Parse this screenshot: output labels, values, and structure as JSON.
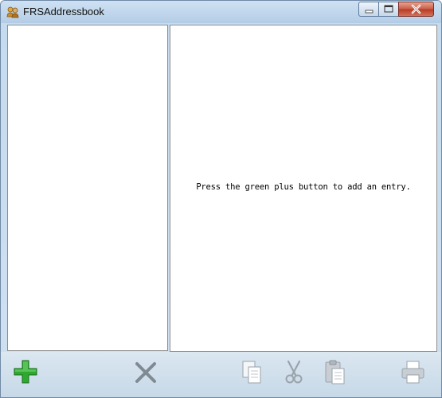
{
  "window": {
    "title": "FRSAddressbook",
    "icon": "addressbook-people-icon"
  },
  "controls": {
    "minimize_icon": "minimize-icon",
    "maximize_icon": "maximize-icon",
    "close_icon": "close-icon"
  },
  "main": {
    "empty_message": "Press the green plus button to add an entry."
  },
  "toolbar": {
    "items": [
      {
        "name": "add",
        "icon": "green-plus-icon",
        "color": "#2fa82f"
      },
      {
        "name": "delete",
        "icon": "x-delete-icon",
        "color": "#7f8a93"
      },
      {
        "name": "copy",
        "icon": "copy-icon"
      },
      {
        "name": "cut",
        "icon": "scissors-icon"
      },
      {
        "name": "paste",
        "icon": "clipboard-paste-icon"
      },
      {
        "name": "print",
        "icon": "printer-icon"
      }
    ]
  }
}
